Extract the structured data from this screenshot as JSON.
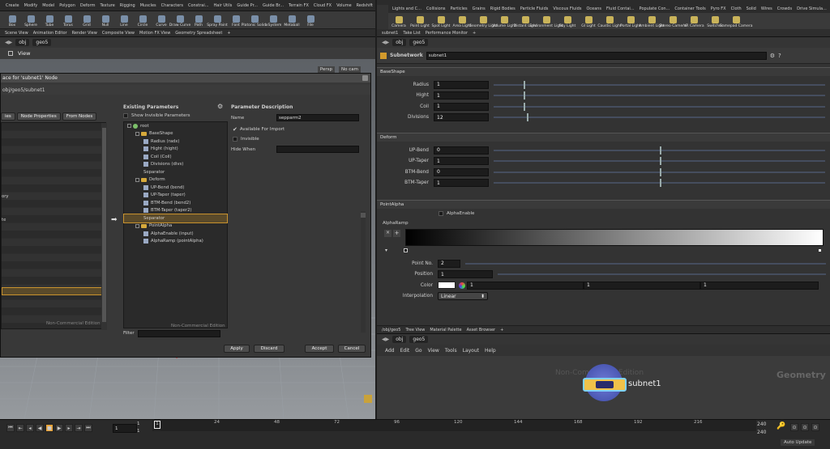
{
  "shelf": {
    "left_tabs": [
      "Create",
      "Modify",
      "Model",
      "Polygon",
      "Deform",
      "Texture",
      "Rigging",
      "Muscles",
      "Characters",
      "Constrai...",
      "Hair Utils",
      "Guide Pr...",
      "Guide Br...",
      "Terrain FX",
      "Cloud FX",
      "Volume",
      "Redshift"
    ],
    "left_tools": [
      "Box",
      "Sphere",
      "Tube",
      "Torus",
      "Grid",
      "Null",
      "Line",
      "Circle",
      "Curve",
      "Draw Curve",
      "Path",
      "Spray Paint",
      "Font",
      "Platonic Solids",
      "L-System",
      "Metaball",
      "File"
    ],
    "right_tabs": [
      "Lights and C...",
      "Collisions",
      "Particles",
      "Grains",
      "Rigid Bodies",
      "Particle Fluids",
      "Viscous Fluids",
      "Oceans",
      "Fluid Contai...",
      "Populate Con...",
      "Container Tools",
      "Pyro FX",
      "Cloth",
      "Solid",
      "Wires",
      "Crowds",
      "Drive Simula..."
    ],
    "right_tools": [
      "Camera",
      "Point Light",
      "Spot Light",
      "Area Light",
      "Geometry Light",
      "Volume Light",
      "Distant Light",
      "Environment Light",
      "Sky Light",
      "GI Light",
      "Caustic Light",
      "Portal Light",
      "Ambient Light",
      "Stereo Camera",
      "VR Camera",
      "Switcher",
      "Gamepad Camera"
    ]
  },
  "left_pane": {
    "tabs": [
      "Scene View",
      "Animation Editor",
      "Render View",
      "Composite View",
      "Motion FX View",
      "Geometry Spreadsheet"
    ],
    "path": [
      "obj",
      "geo5"
    ],
    "view_label": "View",
    "persp": "Persp",
    "cam": "No cam"
  },
  "dialog": {
    "title": "ace for 'subnet1' Node",
    "path": "obj/geo5/subnet1",
    "left_tabs": [
      "ies",
      "Node Properties",
      "From Nodes"
    ],
    "left_items": [
      "ory",
      "te"
    ],
    "watermark": "Non-Commercial Edition",
    "existing_header": "Existing Parameters",
    "show_invisible": "Show Invisible Parameters",
    "tree": [
      {
        "label": "root",
        "kind": "root",
        "indent": 0
      },
      {
        "label": "BaseShape",
        "kind": "folder",
        "indent": 1
      },
      {
        "label": "Radius (radx)",
        "kind": "leaf",
        "indent": 2
      },
      {
        "label": "Hight (hight)",
        "kind": "leaf",
        "indent": 2
      },
      {
        "label": "Coil (Coil)",
        "kind": "leaf",
        "indent": 2
      },
      {
        "label": "Divisions (divs)",
        "kind": "leaf",
        "indent": 2
      },
      {
        "label": "Separator",
        "kind": "plain",
        "indent": 2
      },
      {
        "label": "Deform",
        "kind": "folder",
        "indent": 1
      },
      {
        "label": "UP-Bend (bend)",
        "kind": "leaf",
        "indent": 2
      },
      {
        "label": "UP-Taper (taper)",
        "kind": "leaf",
        "indent": 2
      },
      {
        "label": "BTM-Bend (bend2)",
        "kind": "leaf",
        "indent": 2
      },
      {
        "label": "BTM-Taper (taper2)",
        "kind": "leaf",
        "indent": 2
      },
      {
        "label": "Separator",
        "kind": "selected",
        "indent": 2
      },
      {
        "label": "PointAlpha",
        "kind": "folder",
        "indent": 1
      },
      {
        "label": "AlphaEnable (input)",
        "kind": "leaf",
        "indent": 2
      },
      {
        "label": "AlphaRamp (pointAlpha)",
        "kind": "leaf",
        "indent": 2
      }
    ],
    "filter_label": "Filter",
    "desc_header": "Parameter Description",
    "name_label": "Name",
    "name_value": "sepparm2",
    "available_label": "Available For Import",
    "invisible_label": "Invisible",
    "hide_when_label": "Hide When",
    "buttons": {
      "apply": "Apply",
      "discard": "Discard",
      "accept": "Accept",
      "cancel": "Cancel"
    }
  },
  "right_pane": {
    "tabs": [
      "subnet1",
      "Take List",
      "Performance Monitor"
    ],
    "path": [
      "obj",
      "geo5"
    ],
    "node_type": "Subnetwork",
    "node_name": "subnet1",
    "sections": {
      "baseshape": "BaseShape",
      "deform": "Deform",
      "pointalpha": "PointAlpha"
    },
    "baseshape_params": [
      {
        "label": "Radius",
        "value": "1",
        "pos": 0.09
      },
      {
        "label": "Hight",
        "value": "1",
        "pos": 0.09
      },
      {
        "label": "Coil",
        "value": "1",
        "pos": 0.09
      },
      {
        "label": "Divisions",
        "value": "12",
        "pos": 0.1
      }
    ],
    "deform_params": [
      {
        "label": "UP-Bend",
        "value": "0",
        "pos": 0.5
      },
      {
        "label": "UP-Taper",
        "value": "1",
        "pos": 0.5
      },
      {
        "label": "BTM-Bend",
        "value": "0",
        "pos": 0.5
      },
      {
        "label": "BTM-Taper",
        "value": "1",
        "pos": 0.5
      }
    ],
    "alpha_enable": "AlphaEnable",
    "alpha_ramp": "AlphaRamp",
    "point_no_label": "Point No.",
    "point_no_value": "2",
    "position_label": "Position",
    "position_value": "1",
    "color_label": "Color",
    "color_values": [
      "1",
      "1",
      "1"
    ],
    "interp_label": "Interpolation",
    "interp_value": "Linear"
  },
  "network": {
    "tabs": [
      "/obj/geo5",
      "Tree View",
      "Material Palette",
      "Asset Browser"
    ],
    "path": [
      "obj",
      "geo5"
    ],
    "menu": [
      "Add",
      "Edit",
      "Go",
      "View",
      "Tools",
      "Layout",
      "Help"
    ],
    "node_label": "subnet1",
    "context_label": "Geometry",
    "watermark": "Non-Commercial Edition"
  },
  "timeline": {
    "current_frame": "1",
    "start": "1",
    "start2": "1",
    "ticks": [
      "24",
      "48",
      "72",
      "96",
      "120",
      "144",
      "168",
      "192",
      "216"
    ],
    "end1": "240",
    "end2": "240",
    "auto_update": "Auto Update"
  },
  "colors": {
    "accent": "#e8a33a",
    "selected": "#5a4a2a"
  }
}
